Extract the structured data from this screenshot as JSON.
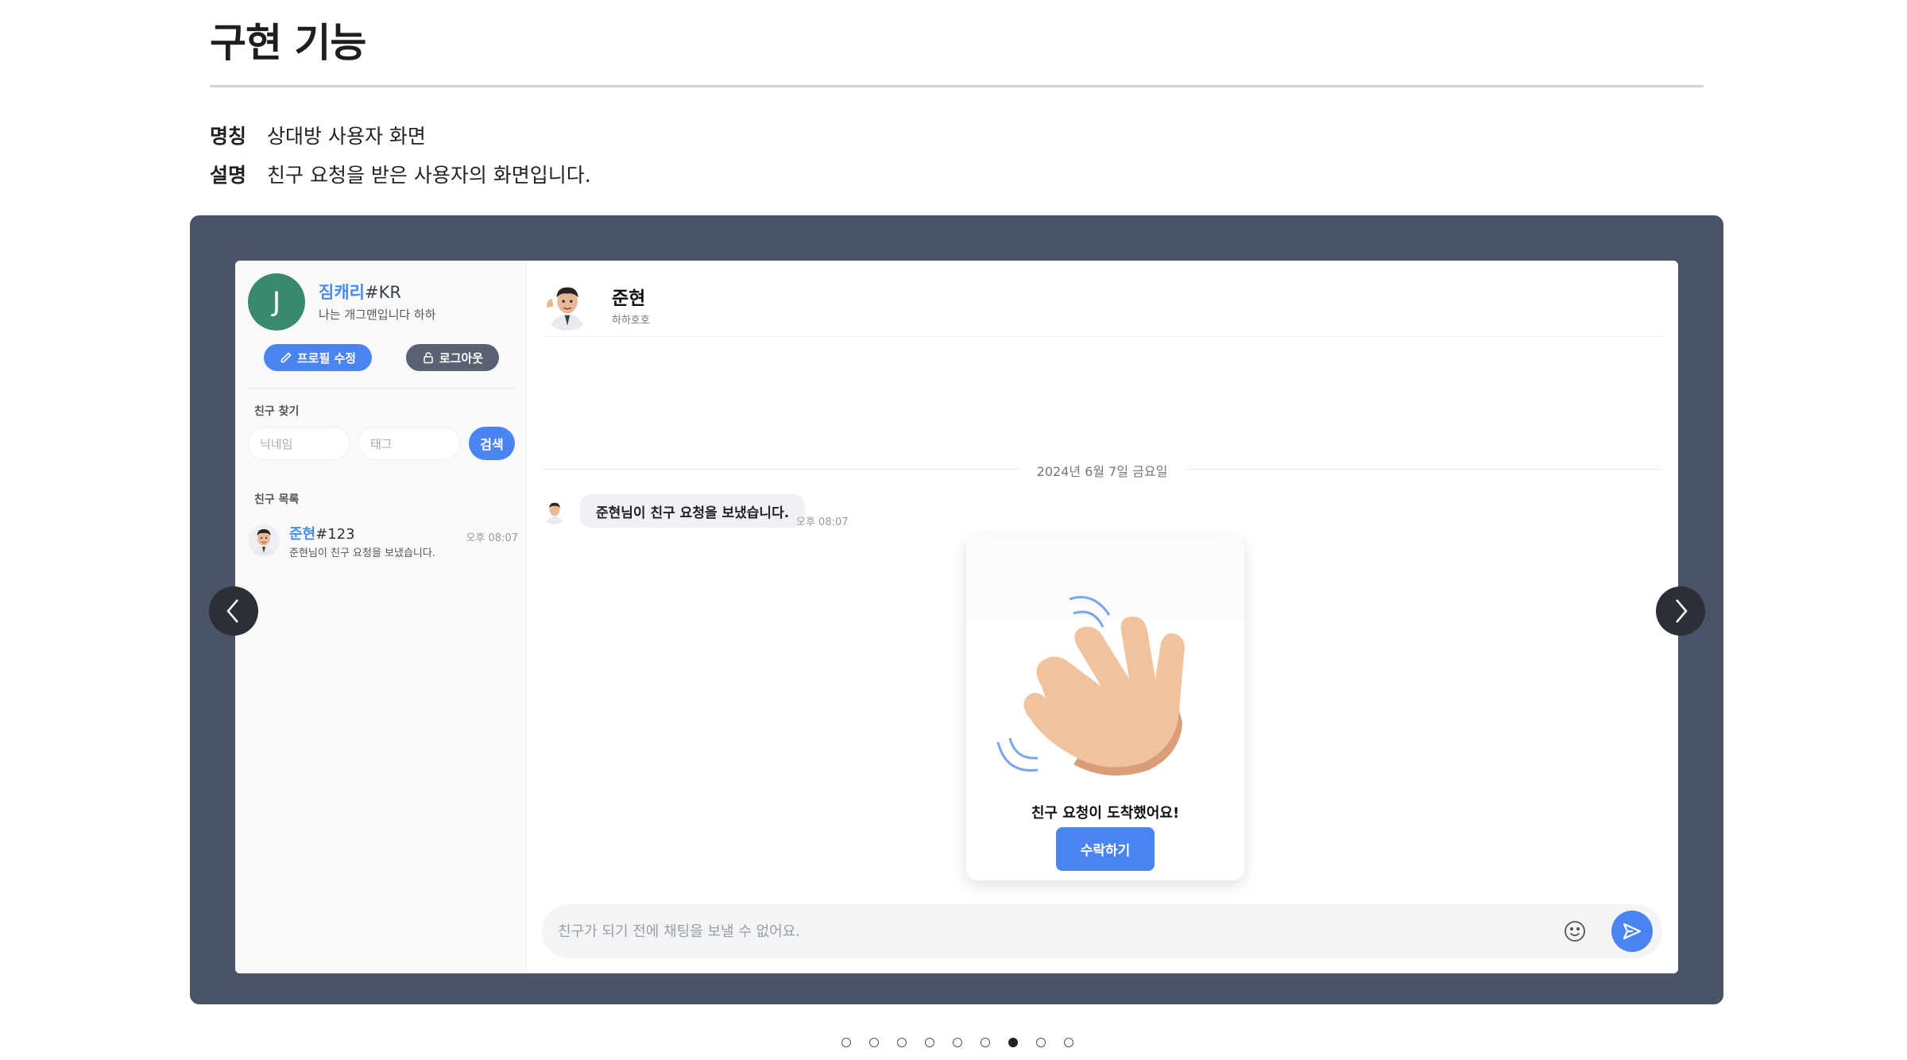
{
  "page": {
    "title": "구현 기능",
    "meta": [
      {
        "key": "명칭",
        "value": "상대방 사용자 화면"
      },
      {
        "key": "설명",
        "value": "친구 요청을 받은 사용자의 화면입니다."
      }
    ]
  },
  "sidebar": {
    "avatar_letter": "J",
    "user_name": "짐캐리",
    "user_tag": "#KR",
    "user_status": "나는 개그맨입니다 하하",
    "edit_profile_label": "프로필 수정",
    "logout_label": "로그아웃",
    "find_friends_label": "친구 찾기",
    "nickname_placeholder": "닉네임",
    "tag_placeholder": "태그",
    "search_label": "검색",
    "friend_list_label": "친구 목록",
    "friends": [
      {
        "name": "준현",
        "tag": "#123",
        "preview": "준현님이 친구 요청을 보냈습니다.",
        "time": "오후 08:07"
      }
    ]
  },
  "chat": {
    "partner_name": "준현",
    "partner_status": "하하호호",
    "date_separator": "2024년 6월 7일 금요일",
    "message_text": "준현님이 친구 요청을 보냈습니다.",
    "message_time": "오후 08:07",
    "request_title": "친구 요청이 도착했어요!",
    "accept_label": "수락하기",
    "composer_placeholder": "친구가 되기 전에 채팅을 보낼 수 없어요."
  },
  "carousel": {
    "dot_count": 9,
    "active_index": 6
  },
  "colors": {
    "accent": "#4a84f0",
    "frame": "#4a5466",
    "avatar_green": "#3a8a6e"
  },
  "icons": [
    "pencil-icon",
    "lock-icon",
    "smile-icon",
    "send-icon",
    "chevron-left-icon",
    "chevron-right-icon",
    "wave-hand-icon"
  ]
}
